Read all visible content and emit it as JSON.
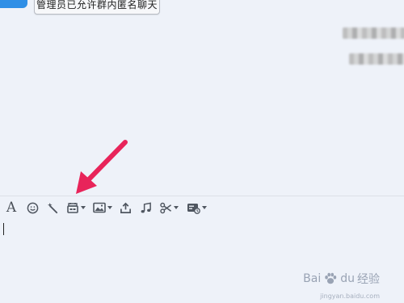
{
  "notice": {
    "text": "管理员已允许群内匿名聊天"
  },
  "toolbar": {
    "font_label": "A",
    "items": [
      {
        "name": "font-icon"
      },
      {
        "name": "emoji-icon"
      },
      {
        "name": "magic-wand-icon"
      },
      {
        "name": "anonymous-chat-icon",
        "has_dropdown": true
      },
      {
        "name": "image-icon",
        "has_dropdown": true
      },
      {
        "name": "upload-icon"
      },
      {
        "name": "music-icon"
      },
      {
        "name": "scissors-icon",
        "has_dropdown": true
      },
      {
        "name": "chat-record-icon",
        "has_dropdown": true
      }
    ]
  },
  "colors": {
    "background": "#eef2f9",
    "arrow": "#e8245a",
    "avatar": "#2f8fe6",
    "icon": "#4f5660"
  },
  "watermark": {
    "brand_left": "Bai",
    "brand_mid": "经验",
    "brand_right": "du",
    "sub": "jingyan.baidu.com"
  }
}
